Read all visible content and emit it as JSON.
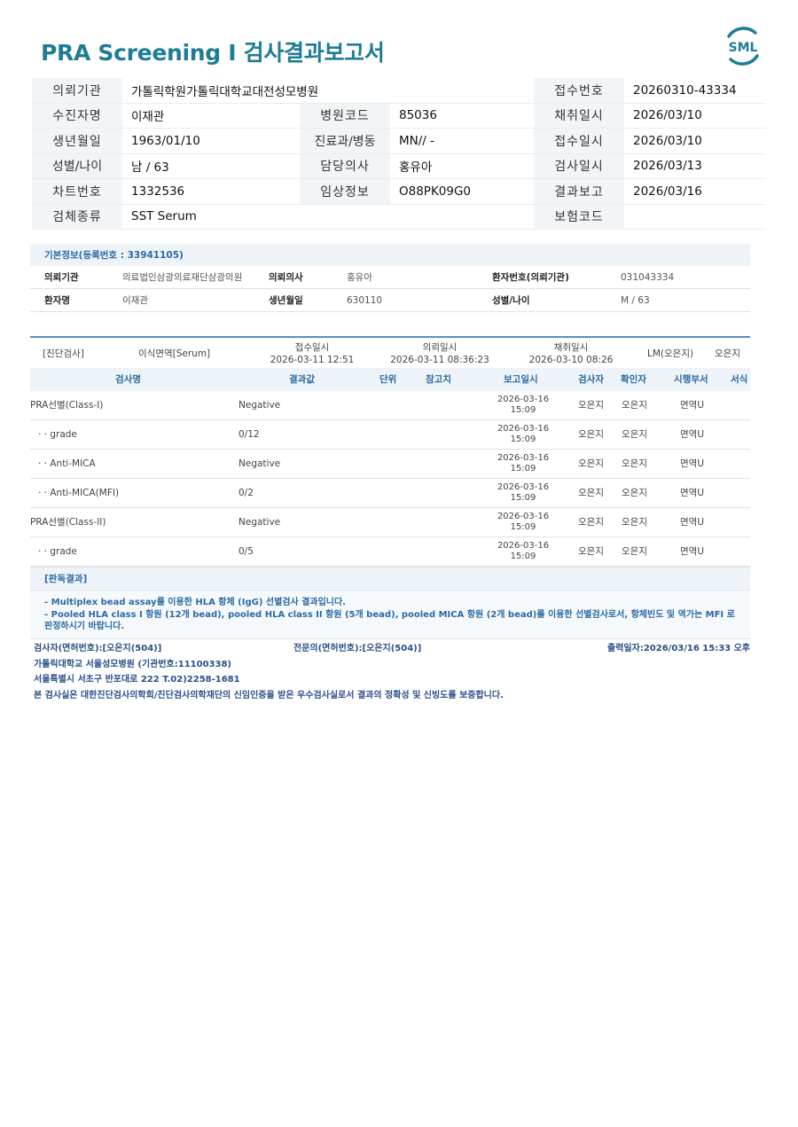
{
  "title": "PRA Screening I 검사결과보고서",
  "logo_text": "SML",
  "header": {
    "institution_label": "의뢰기관",
    "institution": "가톨릭학원가톨릭대학교대전성모병원",
    "receipt_no_label": "접수번호",
    "receipt_no": "20260310-43334",
    "patient_label": "수진자명",
    "patient": "이재관",
    "hospital_code_label": "병원코드",
    "hospital_code": "85036",
    "collect_date_label": "채취일시",
    "collect_date": "2026/03/10",
    "dob_label": "생년월일",
    "dob": "1963/01/10",
    "dept_label": "진료과/병동",
    "dept": "MN// -",
    "receive_date_label": "접수일시",
    "receive_date": "2026/03/10",
    "sex_age_label": "성별/나이",
    "sex_age": "남 / 63",
    "doctor_label": "담당의사",
    "doctor": "홍유아",
    "test_date_label": "검사일시",
    "test_date": "2026/03/13",
    "chart_no_label": "차트번호",
    "chart_no": "1332536",
    "clinical_label": "임상정보",
    "clinical": "O88PK09G0",
    "report_label": "결과보고",
    "report_date": "2026/03/16",
    "specimen_label": "검체종류",
    "specimen": "SST Serum",
    "insurance_label": "보험코드",
    "insurance": ""
  },
  "basic": {
    "heading": "기본정보(등록번호 : 33941105)",
    "row1": {
      "l1": "의뢰기관",
      "v1": "의료법인삼광의료재단삼광의원",
      "l2": "의뢰의사",
      "v2": "홍유아",
      "l3": "환자번호(의뢰기관)",
      "v3": "031043334"
    },
    "row2": {
      "l1": "환자명",
      "v1": "이재관",
      "l2": "생년월일",
      "v2": "630110",
      "l3": "성별/나이",
      "v3": "M / 63"
    }
  },
  "test": {
    "category": "[진단검사]",
    "name": "이식면역[Serum]",
    "receipt_label": "접수일시",
    "receipt_time": "2026-03-11 12:51",
    "request_label": "의뢰일시",
    "request_time": "2026-03-11 08:36:23",
    "collect_label": "채취일시",
    "collect_time": "2026-03-10 08:26",
    "lm": "LM(오은지)",
    "lm_name": "오은지",
    "columns": [
      "검사명",
      "결과값",
      "단위",
      "참고치",
      "보고일시",
      "검사자",
      "확인자",
      "시행부서",
      "서식"
    ],
    "rows": [
      {
        "name": "PRA선별(Class-I)",
        "result": "Negative",
        "date": "2026-03-16",
        "time": "15:09",
        "tester": "오은지",
        "checker": "오은지",
        "dept": "면역U"
      },
      {
        "name": "· · grade",
        "result": "0/12",
        "date": "2026-03-16",
        "time": "15:09",
        "tester": "오은지",
        "checker": "오은지",
        "dept": "면역U"
      },
      {
        "name": "· · Anti-MICA",
        "result": "Negative",
        "date": "2026-03-16",
        "time": "15:09",
        "tester": "오은지",
        "checker": "오은지",
        "dept": "면역U"
      },
      {
        "name": "· · Anti-MICA(MFI)",
        "result": "0/2",
        "date": "2026-03-16",
        "time": "15:09",
        "tester": "오은지",
        "checker": "오은지",
        "dept": "면역U"
      },
      {
        "name": "PRA선별(Class-II)",
        "result": "Negative",
        "date": "2026-03-16",
        "time": "15:09",
        "tester": "오은지",
        "checker": "오은지",
        "dept": "면역U"
      },
      {
        "name": "· · grade",
        "result": "0/5",
        "date": "2026-03-16",
        "time": "15:09",
        "tester": "오은지",
        "checker": "오은지",
        "dept": "면역U"
      }
    ]
  },
  "judgement": {
    "heading": "[판독결과]",
    "line1": "- Multiplex bead assay를 이용한 HLA 항체 (IgG) 선별검사 결과입니다.",
    "line2": "- Pooled HLA class I 항원 (12개 bead), pooled HLA class II 항원 (5개 bead), pooled MICA 항원 (2개 bead)를 이용한 선별검사로서, 항체빈도 및 역가는 MFI 로 판정하시기 바랍니다."
  },
  "footer": {
    "tester": "검사자(면허번호):[오은지(504)]",
    "specialist": "전문의(면허번호):[오은지(504)]",
    "printed": "출력일자:2026/03/16 15:33 오후",
    "hospital": "가톨릭대학교 서울성모병원 (기관번호:11100338)",
    "address": "서울특별시 서초구 반포대로 222 T.02)2258-1681",
    "certification": "본 검사실은 대한진단검사의학회/진단검사의학재단의 신임인증을 받은 우수검사실로서 결과의 정확성 및 신빙도를 보증합니다."
  },
  "colors": {
    "title": "#1e7d95",
    "accent": "#2b6aa3",
    "label_bg": "#f2f5f8"
  }
}
